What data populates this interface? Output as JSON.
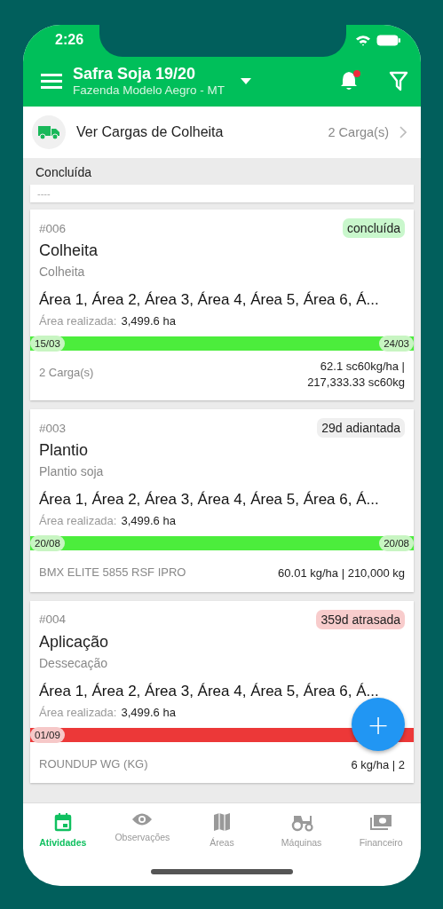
{
  "status_bar": {
    "time": "2:26"
  },
  "header": {
    "title": "Safra Soja 19/20",
    "subtitle": "Fazenda Modelo Aegro - MT",
    "notification_badge": true
  },
  "cargas_row": {
    "label": "Ver Cargas de Colheita",
    "count": "2 Carga(s)"
  },
  "section": {
    "title": "Concluída",
    "placeholder_text": "----"
  },
  "cards": [
    {
      "number": "#006",
      "status": "concluída",
      "kind": "done",
      "title": "Colheita",
      "subtitle": "Colheita",
      "areas": "Área 1, Área 2, Área 3, Área 4, Área 5, Área 6, Á...",
      "area_label": "Área realizada:",
      "area_value": "3,499.6 ha",
      "level": 1,
      "start": "15/03",
      "end": "24/03",
      "footer_left": "2 Carga(s)",
      "footer_right": "62.1 sc60kg/ha | 217,333.33 sc60kg"
    },
    {
      "number": "#003",
      "status": "29d adiantada",
      "kind": "ahead",
      "title": "Plantio",
      "subtitle": "Plantio soja",
      "areas": "Área 1, Área 2, Área 3, Área 4, Área 5, Área 6, Á...",
      "area_label": "Área realizada:",
      "area_value": "3,499.6 ha",
      "level": 1,
      "start": "20/08",
      "end": "20/08",
      "footer_left": "BMX ELITE 5855 RSF IPRO",
      "footer_right": "60.01 kg/ha | 210,000 kg"
    },
    {
      "number": "#004",
      "status": "359d  atrasada",
      "kind": "late",
      "title": "Aplicação",
      "subtitle": "Dessecação",
      "areas": "Área 1, Área 2, Área 3, Área 4, Área 5, Área 6, Á...",
      "area_label": "Área realizada:",
      "area_value": "3,499.6 ha",
      "level": 1,
      "start": "01/09",
      "footer_left": "ROUNDUP WG (KG)",
      "footer_right": "6 kg/ha | 2"
    }
  ],
  "fab": {
    "label": "+"
  },
  "tabs": [
    {
      "label": "Atividades",
      "selected": true,
      "kind": "calendar"
    },
    {
      "label": "Observações",
      "selected": false,
      "kind": "eye"
    },
    {
      "label": "Áreas",
      "selected": false,
      "kind": "map"
    },
    {
      "label": "Máquinas",
      "selected": false,
      "kind": "tractor"
    },
    {
      "label": "Financeiro",
      "selected": false,
      "kind": "money"
    }
  ]
}
